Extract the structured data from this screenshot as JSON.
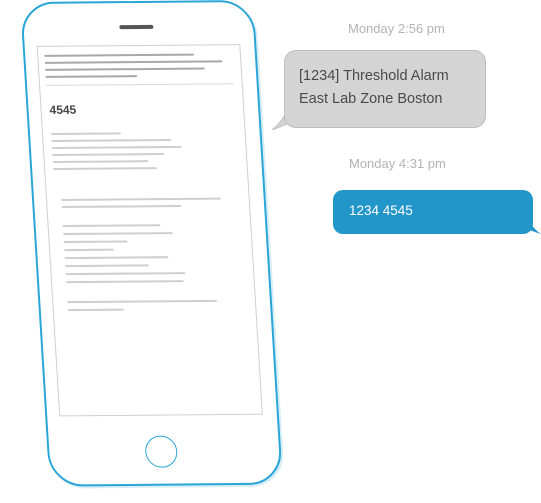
{
  "email": {
    "code": "4545"
  },
  "messages": [
    {
      "timestamp": "Monday 2:56 pm",
      "direction": "incoming",
      "lines": [
        "[1234] Threshold Alarm",
        "East Lab Zone Boston"
      ]
    },
    {
      "timestamp": "Monday 4:31 pm",
      "direction": "outgoing",
      "text": "1234 4545"
    }
  ],
  "colors": {
    "phone_outline": "#2aa5d8",
    "incoming_bubble": "#d4d4d4",
    "outgoing_bubble": "#2396c9",
    "timestamp": "#b3b3b3"
  },
  "icons": {
    "home_button": "home-button-icon"
  }
}
